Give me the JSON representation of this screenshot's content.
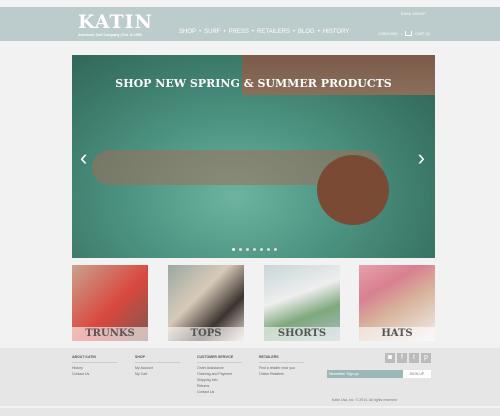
{
  "header": {
    "logo": "KATIN",
    "tagline": "America's Surf Company | Est. in 1959",
    "nav": [
      "SHOP",
      "SURF",
      "PRESS",
      "RETAILERS",
      "BLOG",
      "HISTORY"
    ],
    "email_signup": "EMAIL SIGNUP",
    "login": "LOGIN/JOIN",
    "cart": "CART (0)"
  },
  "hero": {
    "title": "SHOP NEW SPRING & SUMMER PRODUCTS",
    "slides": 7,
    "active_slide": 1
  },
  "categories": [
    "TRUNKS",
    "TOPS",
    "SHORTS",
    "HATS"
  ],
  "footer": {
    "columns": [
      {
        "title": "ABOUT KATIN",
        "links": [
          "History",
          "Contact Us"
        ]
      },
      {
        "title": "SHOP",
        "links": [
          "My Account",
          "My Cart"
        ]
      },
      {
        "title": "CUSTOMER SERVICE",
        "links": [
          "Order Assistance",
          "Ordering and Payment",
          "Shipping Info",
          "Returns",
          "Contact Us"
        ]
      },
      {
        "title": "RETAILERS",
        "links": [
          "Find a retailer near you",
          "Online Retailers"
        ]
      }
    ],
    "newsletter_placeholder": "Newsletter Sign-up",
    "signup": "SIGN UP",
    "copyright": "Katin Usa, Inc. © 2014. All rights reserved",
    "social": [
      "instagram",
      "facebook",
      "twitter",
      "pinterest"
    ]
  }
}
